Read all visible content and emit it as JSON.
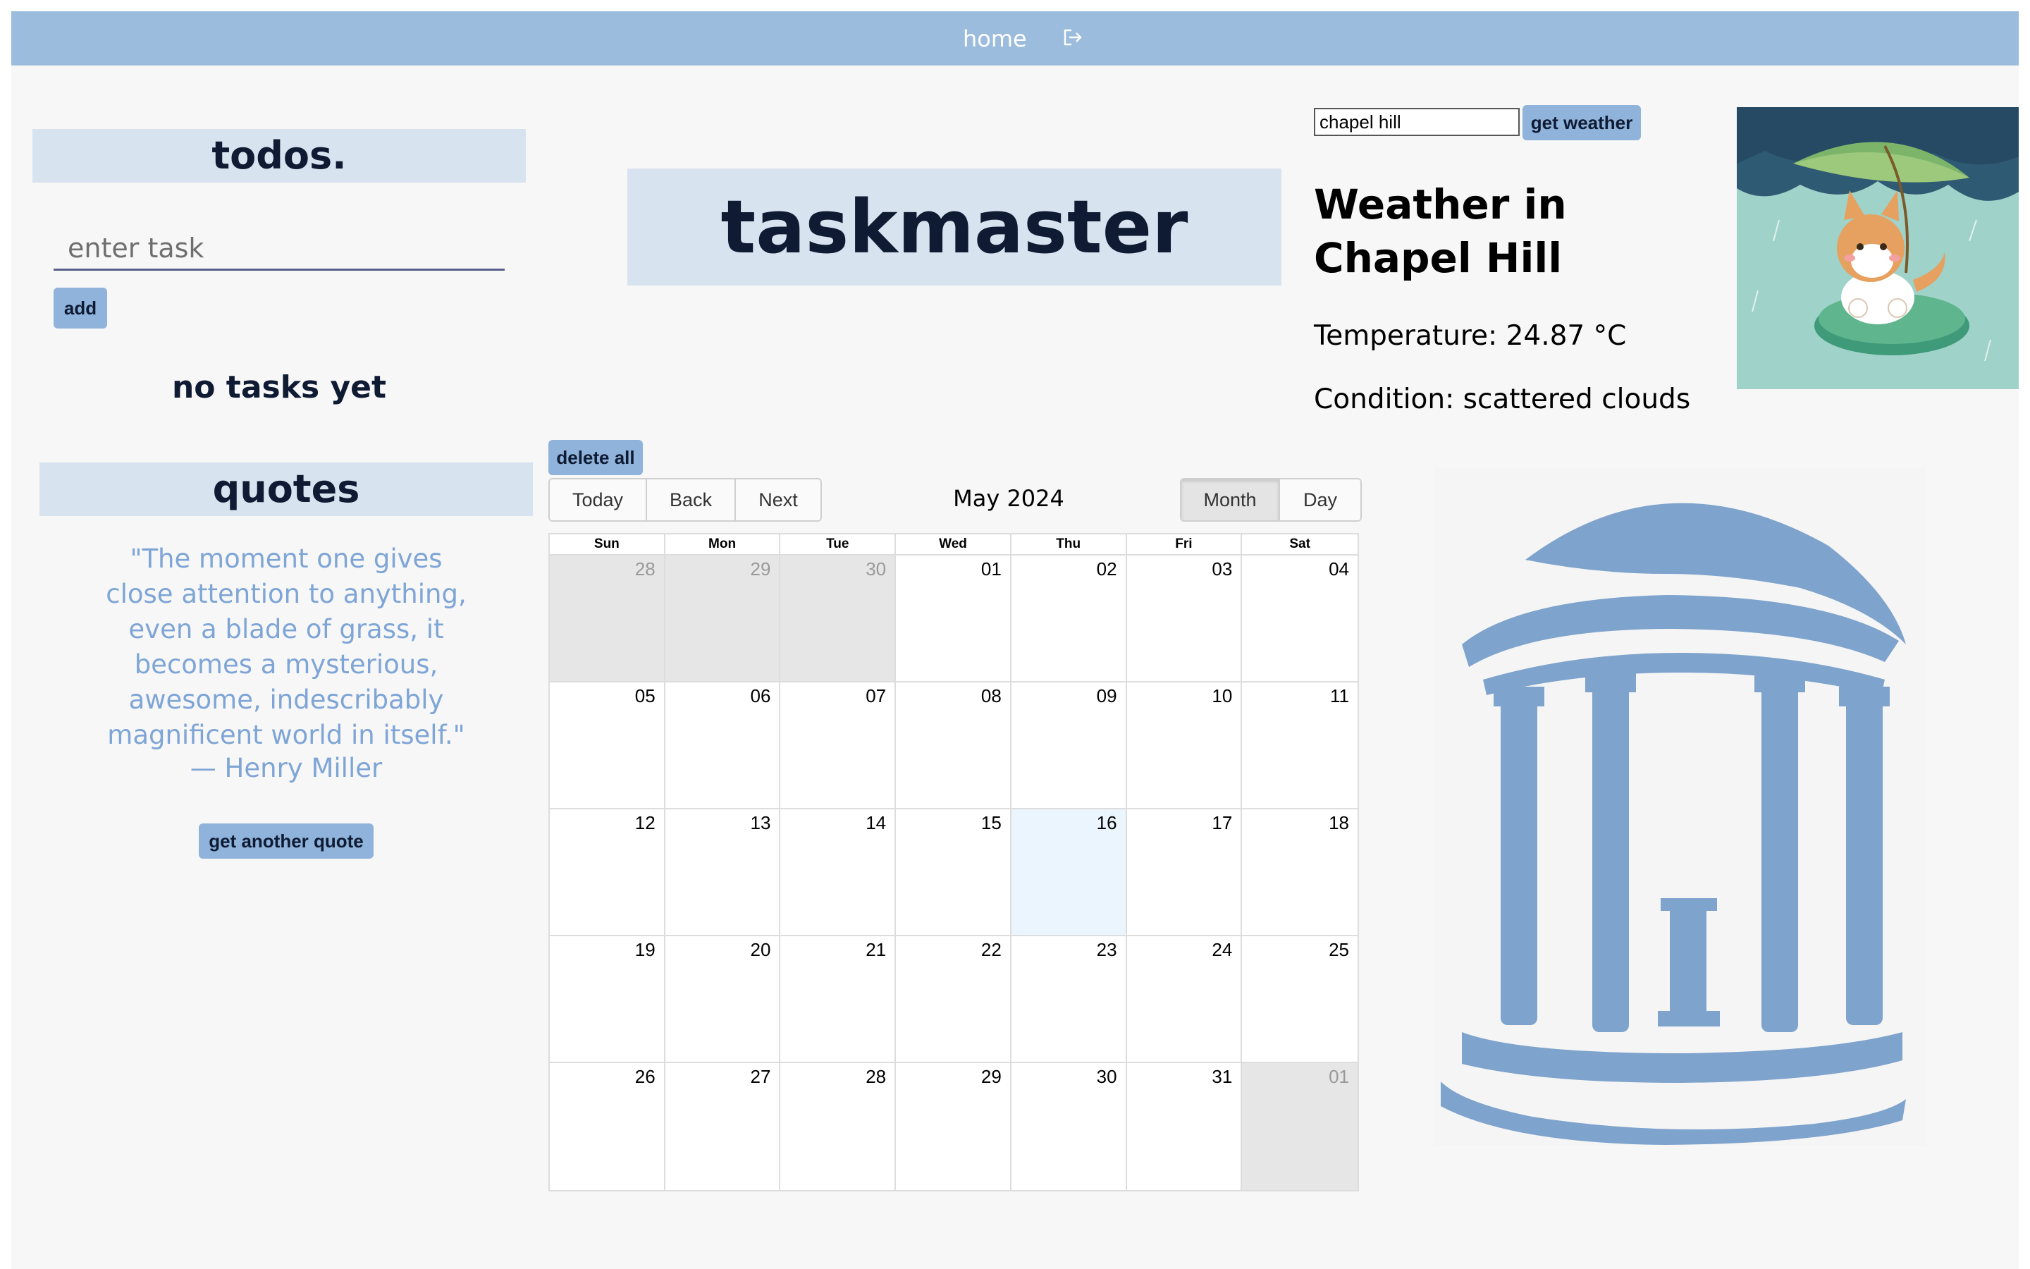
{
  "nav": {
    "home": "home",
    "logout_icon": "logout-icon"
  },
  "todos": {
    "header": "todos.",
    "input_placeholder": "enter task",
    "add_label": "add",
    "empty_text": "no tasks yet"
  },
  "quotes": {
    "header": "quotes",
    "text": "\"The moment one gives close attention to anything, even a blade of grass, it becomes a mysterious, awesome, indescribably magnificent world in itself.\"",
    "author": "— Henry Miller",
    "button_label": "get another quote"
  },
  "title": "taskmaster",
  "weather": {
    "city_value": "chapel hill",
    "button_label": "get weather",
    "title": "Weather in Chapel Hill",
    "temperature": "Temperature: 24.87 °C",
    "condition": "Condition: scattered clouds"
  },
  "images": {
    "corgi": "corgi-umbrella-illustration",
    "well": "old-well-logo"
  },
  "colors": {
    "nav": "#9bbcdc",
    "accent": "#8fb3da",
    "header_bg": "#d7e3ee",
    "quote": "#7ea5d6",
    "well": "#7ea3cc",
    "today": "#eaf5fd"
  },
  "calendar": {
    "delete_all_label": "delete all",
    "today_label": "Today",
    "back_label": "Back",
    "next_label": "Next",
    "label": "May 2024",
    "month_label": "Month",
    "day_label": "Day",
    "active_view": "Month",
    "weekdays": [
      "Sun",
      "Mon",
      "Tue",
      "Wed",
      "Thu",
      "Fri",
      "Sat"
    ],
    "days": [
      {
        "n": "28",
        "off": true
      },
      {
        "n": "29",
        "off": true
      },
      {
        "n": "30",
        "off": true
      },
      {
        "n": "01"
      },
      {
        "n": "02"
      },
      {
        "n": "03"
      },
      {
        "n": "04"
      },
      {
        "n": "05"
      },
      {
        "n": "06"
      },
      {
        "n": "07"
      },
      {
        "n": "08"
      },
      {
        "n": "09"
      },
      {
        "n": "10"
      },
      {
        "n": "11"
      },
      {
        "n": "12"
      },
      {
        "n": "13"
      },
      {
        "n": "14"
      },
      {
        "n": "15"
      },
      {
        "n": "16",
        "today": true
      },
      {
        "n": "17"
      },
      {
        "n": "18"
      },
      {
        "n": "19"
      },
      {
        "n": "20"
      },
      {
        "n": "21"
      },
      {
        "n": "22"
      },
      {
        "n": "23"
      },
      {
        "n": "24"
      },
      {
        "n": "25"
      },
      {
        "n": "26"
      },
      {
        "n": "27"
      },
      {
        "n": "28"
      },
      {
        "n": "29"
      },
      {
        "n": "30"
      },
      {
        "n": "31"
      },
      {
        "n": "01",
        "off": true
      }
    ]
  }
}
